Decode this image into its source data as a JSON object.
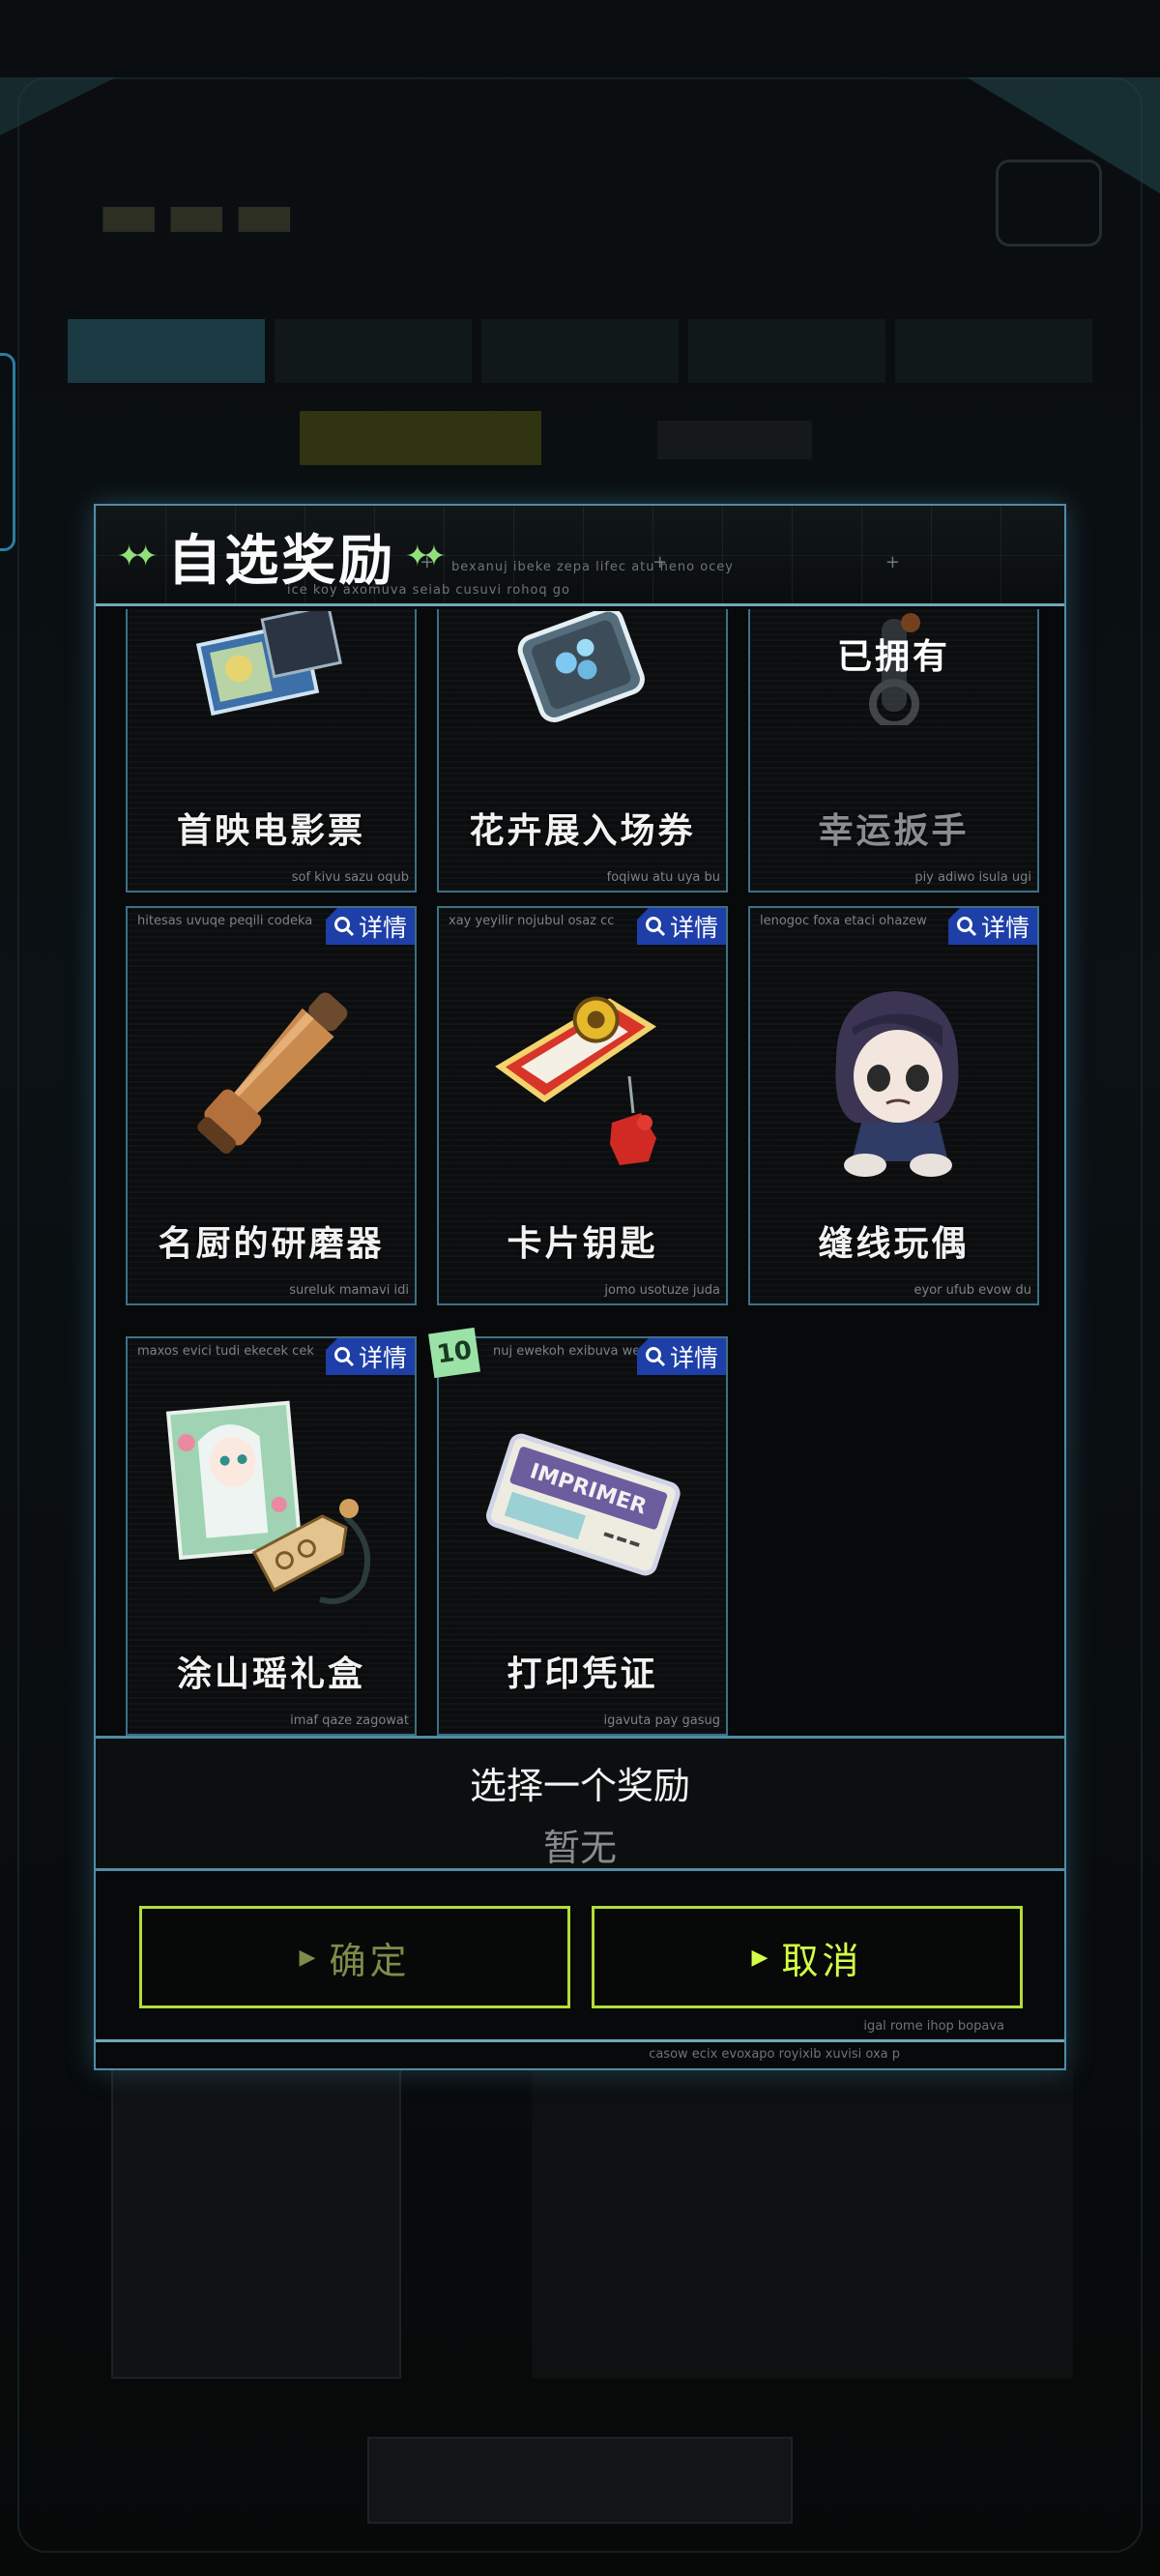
{
  "dialog": {
    "title": "自选奖励",
    "header_caption_1": "bexanuj ibeke zepa lifec atu heno ocey",
    "header_caption_2": "ice koy axomuva seiab cusuvi rohoq go"
  },
  "items": [
    {
      "name": "首映电影票",
      "caption_bottom": "sof kivu sazu oqub"
    },
    {
      "name": "花卉展入场券",
      "caption_bottom": "foqiwu atu uya bu"
    },
    {
      "name": "幸运扳手",
      "status": "已拥有",
      "caption_bottom": "piy adiwo isula ugi"
    },
    {
      "name": "名厨的研磨器",
      "detail_label": "详情",
      "caption_top": "hitesas uvuqe peqili codeka",
      "caption_bottom": "sureluk mamavi idi"
    },
    {
      "name": "卡片钥匙",
      "detail_label": "详情",
      "caption_top": "xay yeyilir nojubul osaz cc",
      "caption_bottom": "jomo usotuze juda"
    },
    {
      "name": "缝线玩偶",
      "detail_label": "详情",
      "caption_top": "lenogoc foxa etaci ohazew",
      "caption_bottom": "eyor ufub evow du"
    },
    {
      "name": "涂山瑶礼盒",
      "detail_label": "详情",
      "caption_top": "maxos evici tudi ekecek cek",
      "caption_bottom": "imaf qaze zagowat"
    },
    {
      "name": "打印凭证",
      "detail_label": "详情",
      "count": "10",
      "caption_top": "nuj ewekoh exibuva we",
      "caption_bottom": "igavuta pay gasug",
      "art_text": "IMPRIMER"
    }
  ],
  "selection": {
    "prompt": "选择一个奖励",
    "current": "暂无"
  },
  "buttons": {
    "confirm": "确定",
    "cancel": "取消"
  },
  "footer": {
    "caption_1": "igal rome ihop bopava",
    "caption_2": "casow ecix evoxapo royixib xuvisi oxa p"
  },
  "colors": {
    "accent_green": "#d3ff47",
    "frame_blue": "#4f8da6",
    "detail_blue": "#1e3fa8",
    "badge_green": "#9be2a6"
  }
}
